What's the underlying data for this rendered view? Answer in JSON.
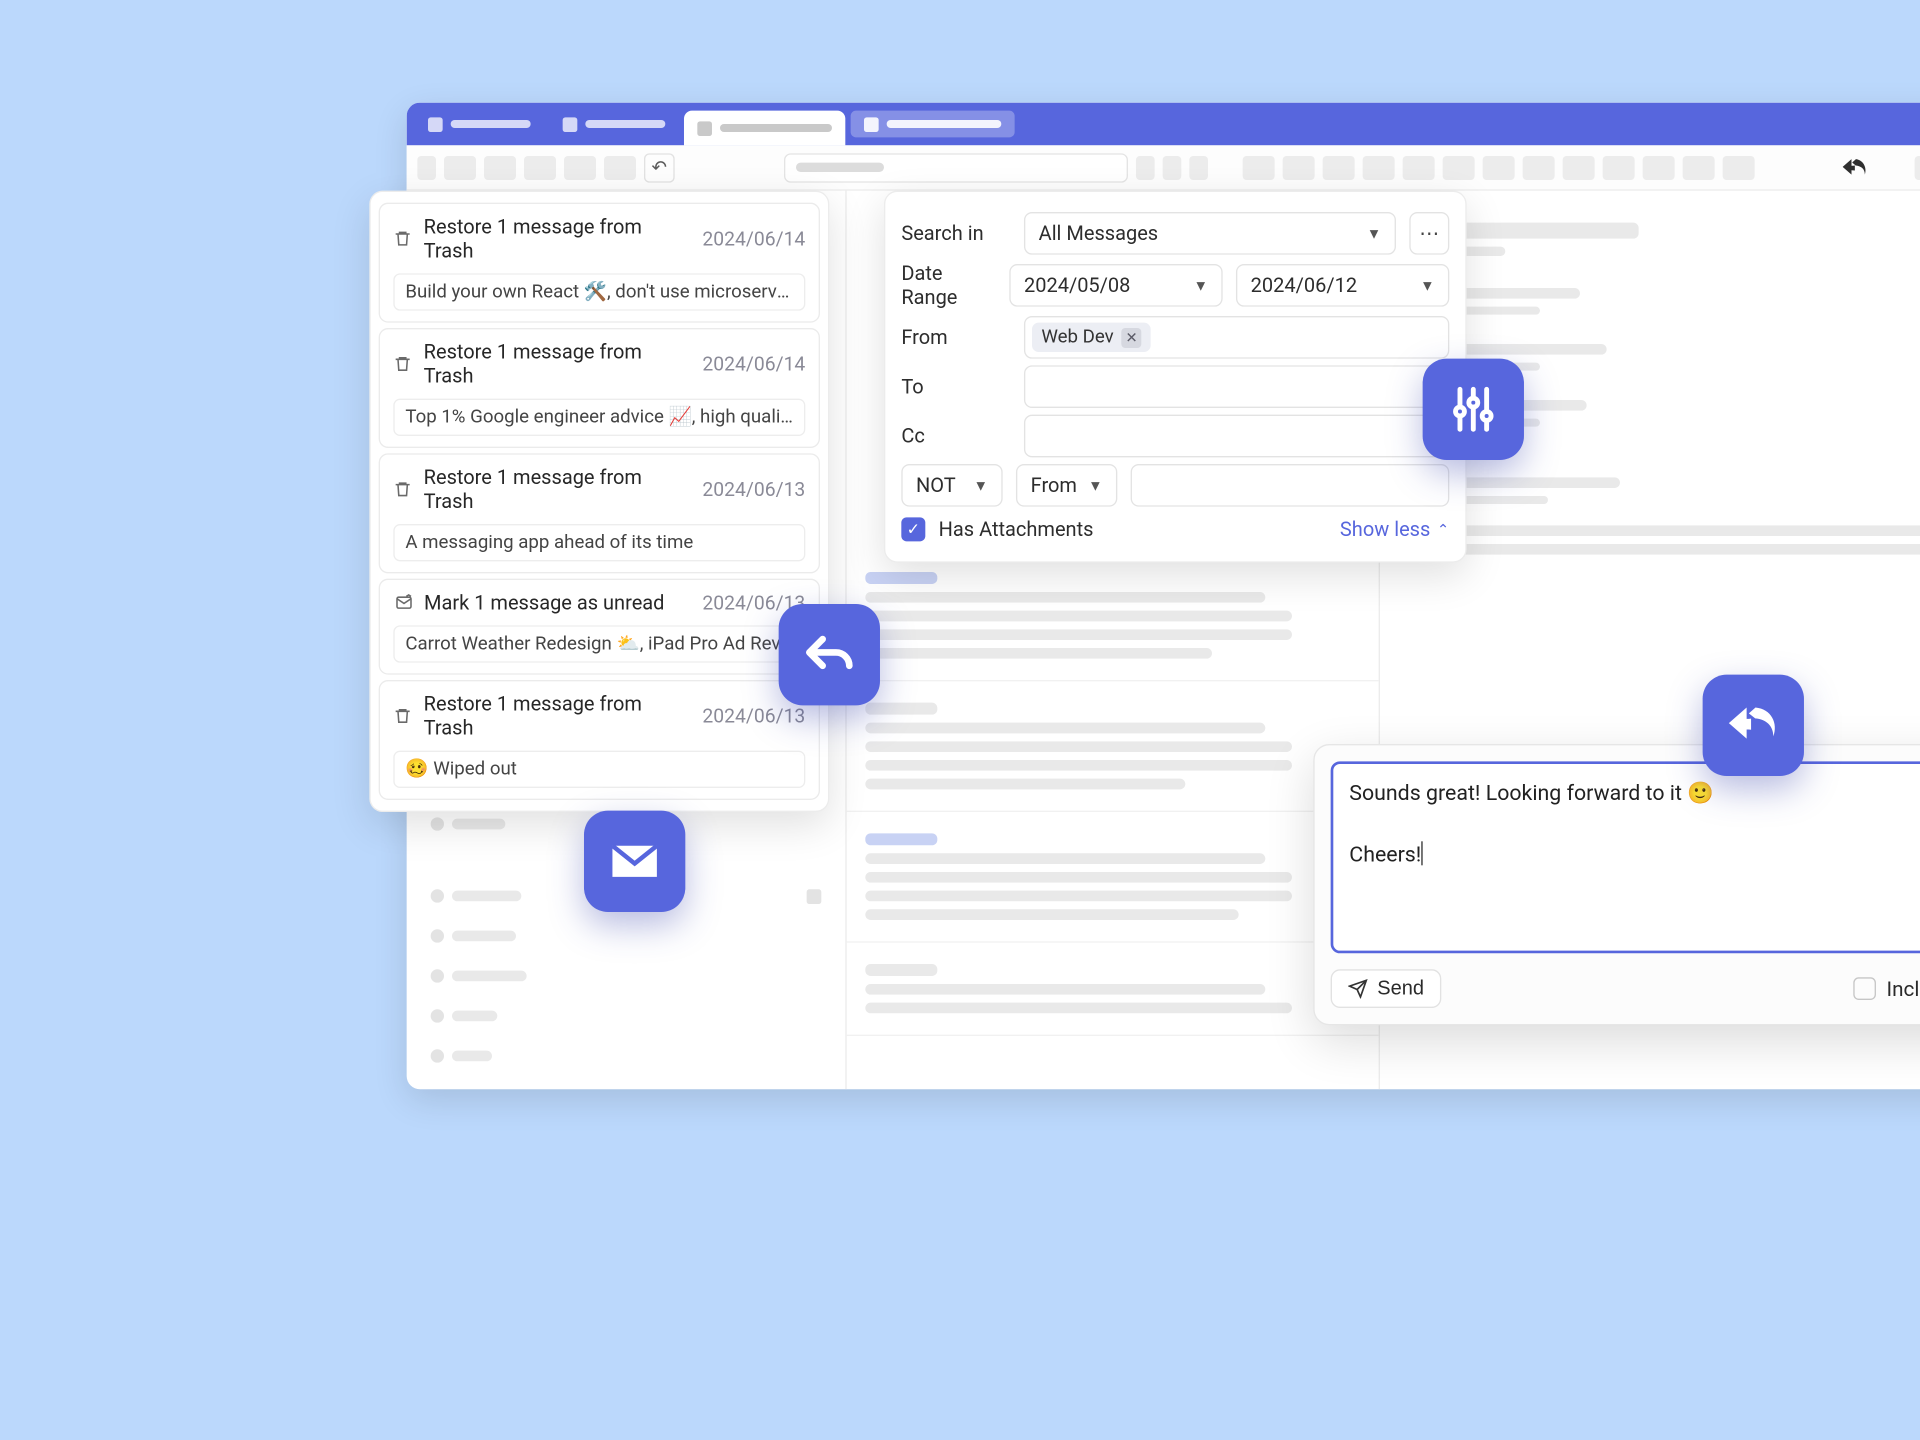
{
  "history": [
    {
      "icon": "trash",
      "title": "Restore 1 message from Trash",
      "date": "2024/06/14",
      "sub": "Build your own React 🛠️, don't use microservic…"
    },
    {
      "icon": "trash",
      "title": "Restore 1 message from Trash",
      "date": "2024/06/14",
      "sub": "Top 1% Google engineer advice 📈, high quality…"
    },
    {
      "icon": "trash",
      "title": "Restore 1 message from Trash",
      "date": "2024/06/13",
      "sub": "A messaging app ahead of its time"
    },
    {
      "icon": "unread",
      "title": "Mark 1 message as unread",
      "date": "2024/06/13",
      "sub": "Carrot Weather Redesign ⛅, iPad Pro Ad Revis…"
    },
    {
      "icon": "trash",
      "title": "Restore 1 message from Trash",
      "date": "2024/06/13",
      "sub": "🥴 Wiped out"
    }
  ],
  "search": {
    "label_searchin": "Search in",
    "select_all": "All Messages",
    "label_daterange": "Date Range",
    "date_start": "2024/05/08",
    "date_end": "2024/06/12",
    "label_from": "From",
    "chip_from": "Web Dev",
    "label_to": "To",
    "label_cc": "Cc",
    "cond_not": "NOT",
    "cond_field": "From",
    "has_attach": "Has Attachments",
    "show_less": "Show less"
  },
  "reply": {
    "body": "Sounds great! Looking forward to it 🙂\n\nCheers!",
    "send": "Send",
    "quoted": "Include Quoted Text"
  }
}
